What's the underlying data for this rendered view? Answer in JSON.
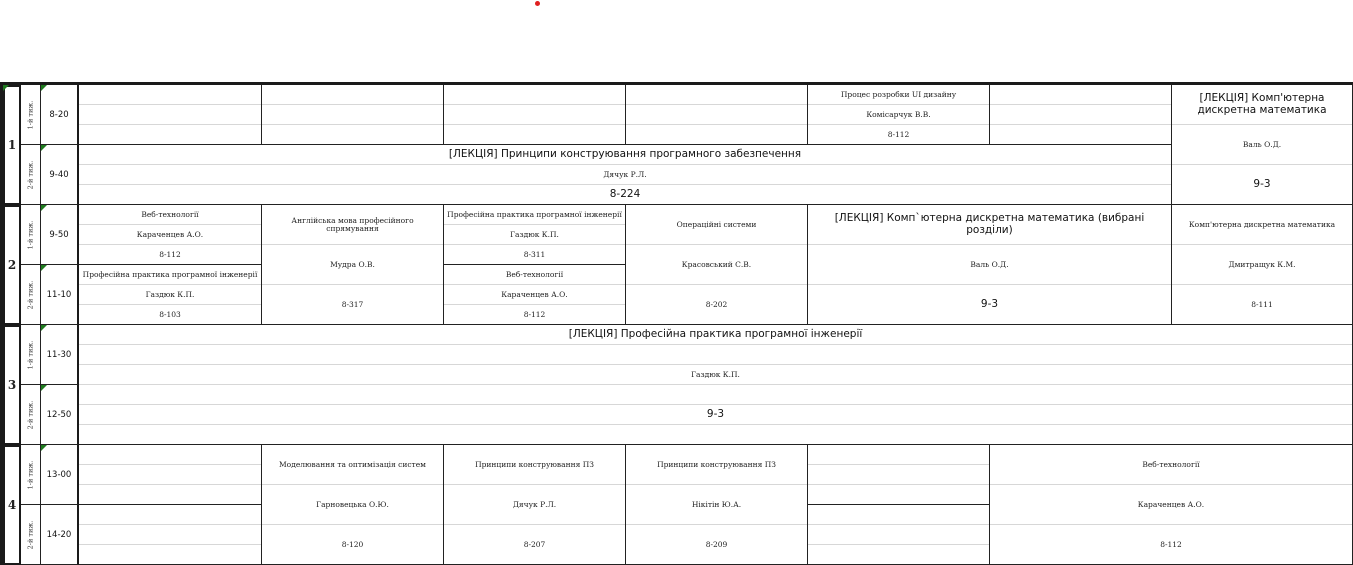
{
  "days": [
    "1",
    "2",
    "3",
    "4"
  ],
  "week_labels": [
    "1-й тиж.",
    "2-й тиж."
  ],
  "times": [
    "8-20",
    "9-40",
    "9-50",
    "11-10",
    "11-30",
    "12-50",
    "13-00",
    "14-20"
  ],
  "day1": {
    "col5": {
      "subject": "Процес розробки UI дизайну",
      "teacher": "Комісарчук В.В.",
      "room": "8-112"
    },
    "col7": {
      "subject": "[ЛЕКЦІЯ] Комп'ютерна дискретна математика",
      "teacher": "Валь О.Д.",
      "room": "9-3"
    },
    "lecture": {
      "subject": "[ЛЕКЦІЯ] Принципи конструювання програмного забезпечення",
      "teacher": "Дячук Р.Л.",
      "room": "8-224"
    }
  },
  "day2": {
    "col1_w1": {
      "subject": "Веб-технології",
      "teacher": "Караченцев А.О.",
      "room": "8-112"
    },
    "col1_w2": {
      "subject": "Професійна практика програмної інженерії",
      "teacher": "Газдюк К.П.",
      "room": "8-103"
    },
    "col2": {
      "subject": "Англійська мова професійного спрямування",
      "teacher": "Мудра О.В.",
      "room": "8-317"
    },
    "col3_w1": {
      "subject": "Професійна практика програмної інженерії",
      "teacher": "Газдюк К.П.",
      "room": "8-311"
    },
    "col3_w2": {
      "subject": "Веб-технології",
      "teacher": "Караченцев А.О.",
      "room": "8-112"
    },
    "col4": {
      "subject": "Операційні системи",
      "teacher": "Красовський С.В.",
      "room": "8-202"
    },
    "col56": {
      "subject": "[ЛЕКЦІЯ] Комп`ютерна дискретна математика (вибрані розділи)",
      "teacher": "Валь О.Д.",
      "room": "9-3"
    },
    "col7": {
      "subject": "Комп'ютерна дискретна математика",
      "teacher": "Дмитращук К.М.",
      "room": "8-111"
    }
  },
  "day3": {
    "lecture": {
      "subject": "[ЛЕКЦІЯ] Професійна практика програмної інженерії",
      "teacher": "Газдюк К.П.",
      "room": "9-3"
    }
  },
  "day4": {
    "col2": {
      "subject": "Моделювання та оптимізація систем",
      "teacher": "Гарновецька О.Ю.",
      "room": "8-120"
    },
    "col3": {
      "subject": "Принципи конструювання ПЗ",
      "teacher": "Дячук Р.Л.",
      "room": "8-207"
    },
    "col4": {
      "subject": "Принципи конструювання ПЗ",
      "teacher": "Нікітін Ю.А.",
      "room": "8-209"
    },
    "col67": {
      "subject": "Веб-технології",
      "teacher": "Караченцев А.О.",
      "room": "8-112"
    }
  }
}
